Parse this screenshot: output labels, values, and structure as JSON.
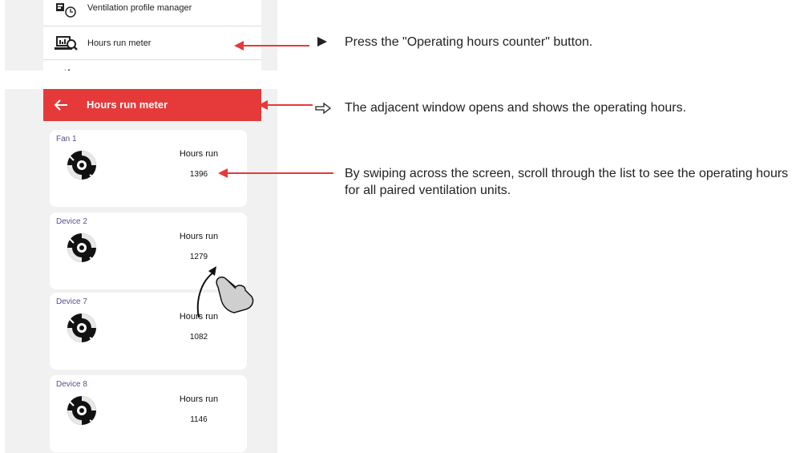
{
  "menu": {
    "items": [
      {
        "label": "Ventilation profile manager",
        "icon": "profile-clock-icon"
      },
      {
        "label": "Hours run meter",
        "icon": "hours-meter-icon"
      },
      {
        "label": "",
        "icon": "fan-icon"
      }
    ]
  },
  "screen": {
    "header_title": "Hours run meter",
    "back_icon": "arrow-left-icon",
    "devices": [
      {
        "name": "Fan 1",
        "label": "Hours run",
        "value": "1396"
      },
      {
        "name": "Device 2",
        "label": "Hours run",
        "value": "1279"
      },
      {
        "name": "Device 7",
        "label": "Hours run",
        "value": "1082"
      },
      {
        "name": "Device 8",
        "label": "Hours run",
        "value": "1146"
      }
    ]
  },
  "annotations": {
    "step_1": "Press the \"Operating hours counter\" button.",
    "step_2": "The adjacent window opens and shows the operating hours.",
    "step_3": "By swiping across the screen, scroll through the list to see the operating hours for all paired ventilation units."
  },
  "colors": {
    "accent": "#e63a3a",
    "device_name": "#5b4d8f",
    "panel_bg": "#f1f1f1"
  }
}
